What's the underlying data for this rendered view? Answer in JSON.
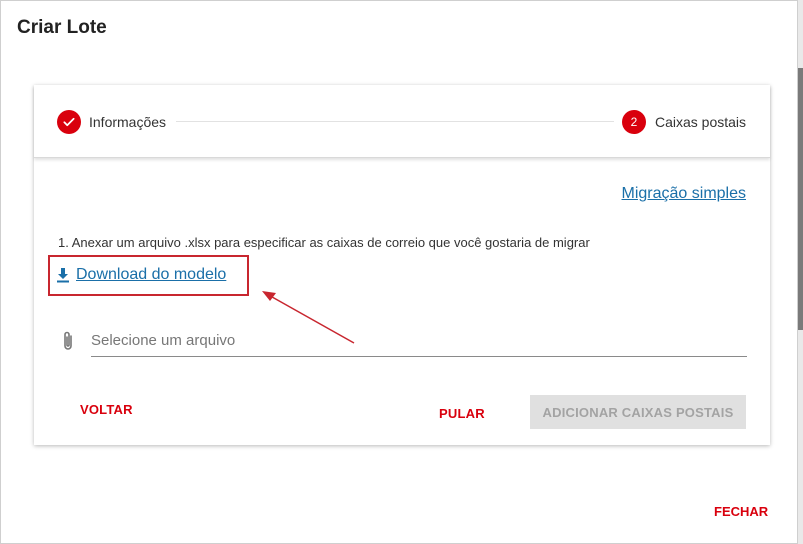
{
  "dialog": {
    "title": "Criar Lote"
  },
  "stepper": {
    "steps": [
      {
        "label": "Informações",
        "state": "completed",
        "icon": "check-icon"
      },
      {
        "label": "Caixas postais",
        "state": "active",
        "number": "2"
      }
    ]
  },
  "content": {
    "simple_migration_link": "Migração simples",
    "instruction": "1. Anexar um arquivo .xlsx para especificar as caixas de correio que você gostaria de migrar",
    "download_link": "Download do modelo",
    "download_icon": "download-icon",
    "file_input": {
      "placeholder": "Selecione um arquivo",
      "icon": "paperclip-icon"
    }
  },
  "actions": {
    "back": "VOLTAR",
    "skip": "PULAR",
    "add": "ADICIONAR CAIXAS POSTAIS"
  },
  "footer": {
    "close": "FECHAR"
  },
  "colors": {
    "accent": "#d9000d",
    "link": "#1a6fa8",
    "annotation": "#c8262f"
  }
}
